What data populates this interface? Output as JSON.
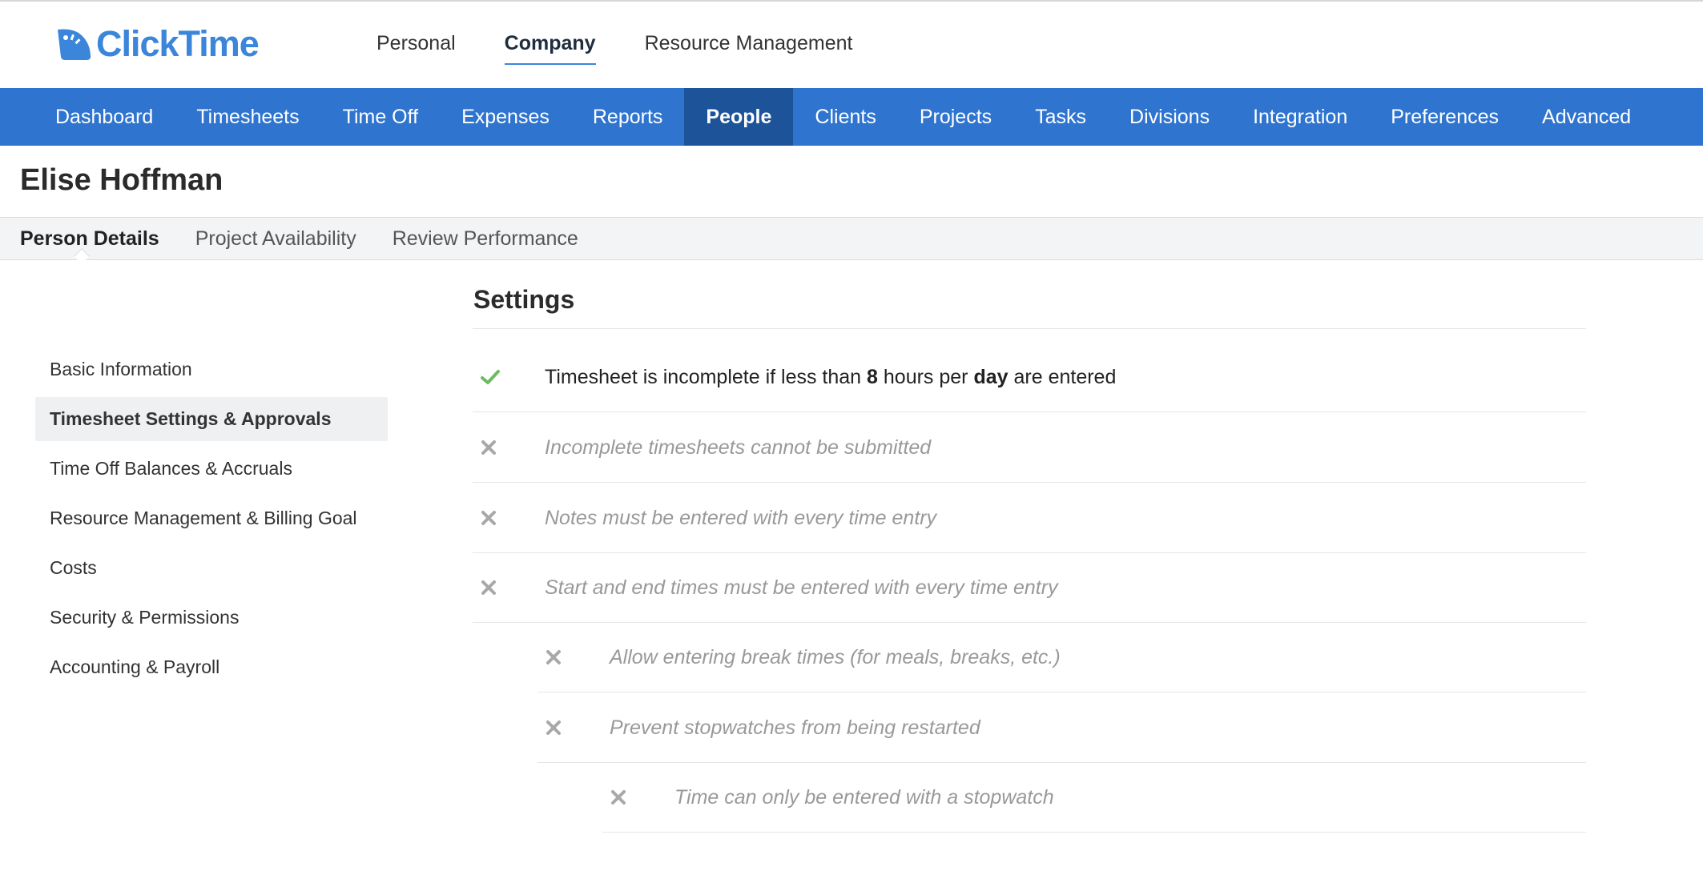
{
  "app": {
    "name": "ClickTime",
    "brand_color": "#3b86da"
  },
  "top_nav": [
    {
      "label": "Personal",
      "active": false
    },
    {
      "label": "Company",
      "active": true
    },
    {
      "label": "Resource Management",
      "active": false
    }
  ],
  "main_nav": [
    {
      "label": "Dashboard",
      "active": false
    },
    {
      "label": "Timesheets",
      "active": false
    },
    {
      "label": "Time Off",
      "active": false
    },
    {
      "label": "Expenses",
      "active": false
    },
    {
      "label": "Reports",
      "active": false
    },
    {
      "label": "People",
      "active": true
    },
    {
      "label": "Clients",
      "active": false
    },
    {
      "label": "Projects",
      "active": false
    },
    {
      "label": "Tasks",
      "active": false
    },
    {
      "label": "Divisions",
      "active": false
    },
    {
      "label": "Integration",
      "active": false
    },
    {
      "label": "Preferences",
      "active": false
    },
    {
      "label": "Advanced",
      "active": false
    }
  ],
  "person": {
    "name": "Elise Hoffman"
  },
  "sub_tabs": [
    {
      "label": "Person Details",
      "active": true
    },
    {
      "label": "Project Availability",
      "active": false
    },
    {
      "label": "Review Performance",
      "active": false
    }
  ],
  "sidebar": [
    {
      "label": "Basic Information",
      "active": false
    },
    {
      "label": "Timesheet Settings & Approvals",
      "active": true
    },
    {
      "label": "Time Off Balances & Accruals",
      "active": false
    },
    {
      "label": "Resource Management & Billing Goal",
      "active": false
    },
    {
      "label": "Costs",
      "active": false
    },
    {
      "label": "Security & Permissions",
      "active": false
    },
    {
      "label": "Accounting & Payroll",
      "active": false
    }
  ],
  "settings": {
    "title": "Settings",
    "rows": [
      {
        "enabled": true,
        "icon": "check-icon",
        "text_parts": [
          "Timesheet is incomplete if less than ",
          "8",
          " hours per ",
          "day",
          " are entered"
        ]
      },
      {
        "enabled": false,
        "icon": "x-icon",
        "text": "Incomplete timesheets cannot be submitted"
      },
      {
        "enabled": false,
        "icon": "x-icon",
        "text": "Notes must be entered with every time entry"
      },
      {
        "enabled": false,
        "icon": "x-icon",
        "text": "Start and end times must be entered with every time entry"
      },
      {
        "enabled": false,
        "icon": "x-icon",
        "text": "Allow entering break times (for meals, breaks, etc.)"
      },
      {
        "enabled": false,
        "icon": "x-icon",
        "text": "Prevent stopwatches from being restarted"
      },
      {
        "enabled": false,
        "icon": "x-icon",
        "text": "Time can only be entered with a stopwatch"
      }
    ]
  },
  "colors": {
    "nav_bg": "#2f74cf",
    "nav_active_bg": "#1d5499",
    "check_green": "#6dbb5d",
    "x_gray": "#a8a8a8"
  }
}
